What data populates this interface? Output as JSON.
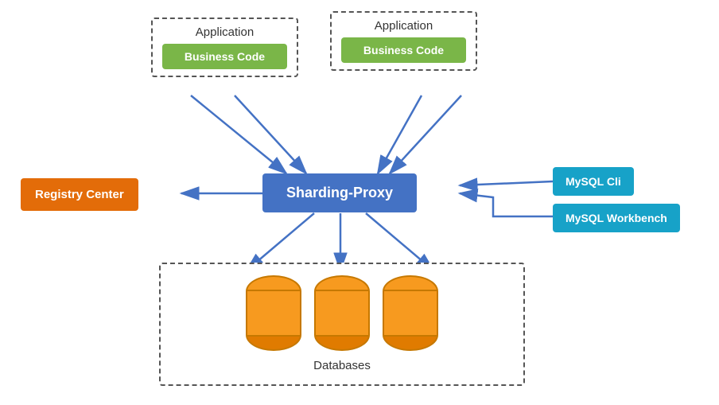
{
  "app1": {
    "label": "Application",
    "business_code": "Business Code"
  },
  "app2": {
    "label": "Application",
    "business_code": "Business Code"
  },
  "sharding_proxy": {
    "label": "Sharding-Proxy"
  },
  "registry_center": {
    "label": "Registry Center"
  },
  "mysql_cli": {
    "label": "MySQL Cli"
  },
  "mysql_workbench": {
    "label": "MySQL Workbench"
  },
  "databases": {
    "label": "Databases"
  }
}
